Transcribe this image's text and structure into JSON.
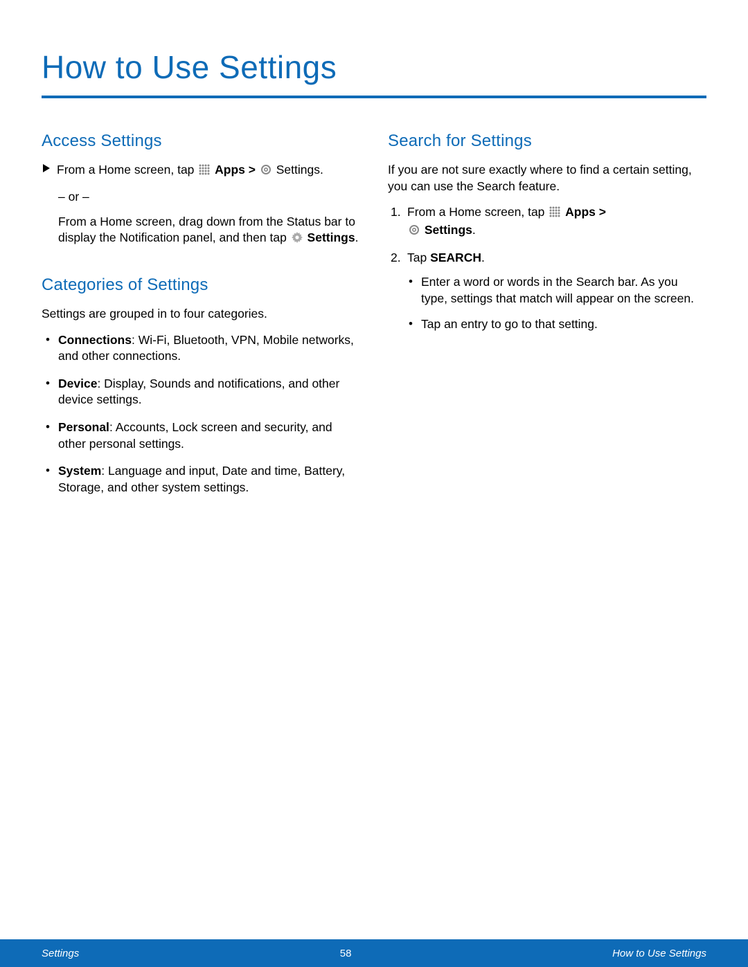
{
  "page_title": "How to Use Settings",
  "left": {
    "access": {
      "heading": "Access Settings",
      "line1a": "From a Home screen, tap ",
      "apps_label": "Apps > ",
      "settings_label": " Settings.",
      "or": "– or –",
      "line2a": "From a Home screen, drag down from the Status bar to display the Notification panel, and then tap ",
      "settings_bold": "Settings",
      "period": "."
    },
    "categories": {
      "heading": "Categories of Settings",
      "intro": "Settings are grouped in to four categories.",
      "items": [
        {
          "label": "Connections",
          "desc": ": Wi-Fi, Bluetooth, VPN, Mobile networks, and other connections."
        },
        {
          "label": "Device",
          "desc": ": Display, Sounds and notifications, and other device settings."
        },
        {
          "label": "Personal",
          "desc": ": Accounts, Lock screen and security, and other personal settings."
        },
        {
          "label": "System",
          "desc": ": Language and input, Date and time, Battery, Storage, and other system settings."
        }
      ]
    }
  },
  "right": {
    "search": {
      "heading": "Search for Settings",
      "intro": "If you are not sure exactly where to find a certain setting, you can use the Search feature.",
      "step1a": "From a Home screen, tap ",
      "apps_label": "Apps >",
      "settings_bold": "Settings",
      "period": ".",
      "step2a": "Tap ",
      "search_bold": "SEARCH",
      "step2b": ".",
      "sub": [
        "Enter a word or words in the Search bar. As you type, settings that match will appear on the screen.",
        "Tap an entry to go to that setting."
      ]
    }
  },
  "footer": {
    "left": "Settings",
    "center": "58",
    "right": "How to Use Settings"
  }
}
